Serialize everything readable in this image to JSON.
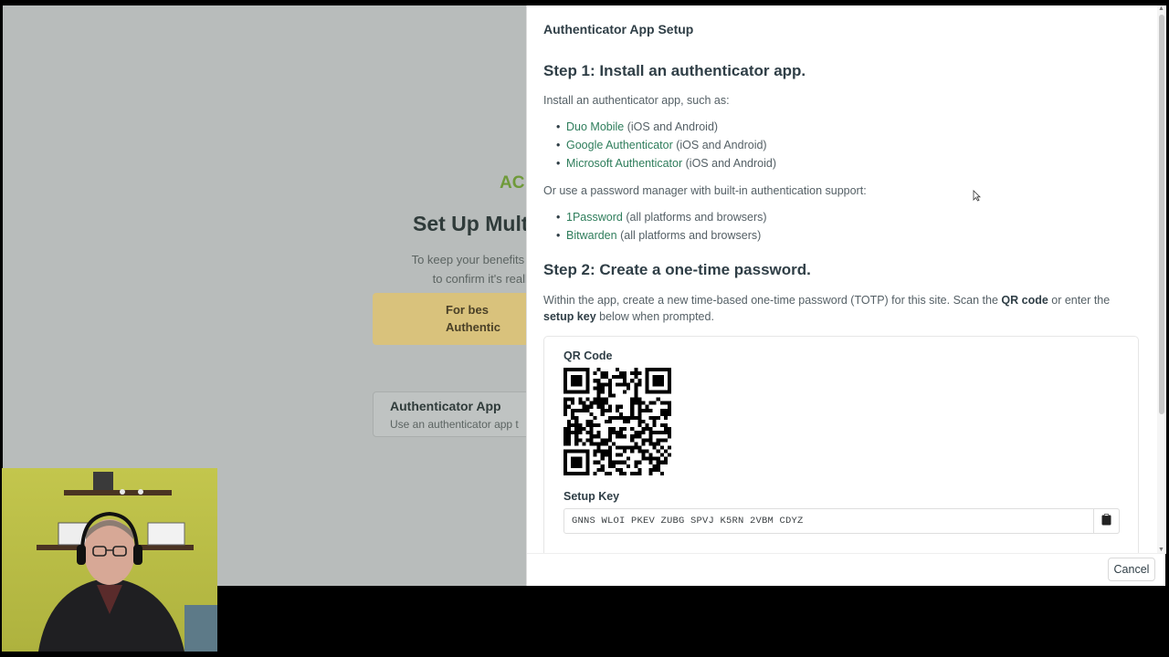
{
  "background": {
    "brand_fragment": "AC",
    "title_fragment": "Set Up Mult",
    "desc_line1": "To keep your benefits inforr",
    "desc_line2": "to confirm it's really",
    "notice_line1": "For bes",
    "notice_line2": "Authentic",
    "card_title": "Authenticator App",
    "card_desc": "Use an authenticator app t"
  },
  "modal": {
    "title": "Authenticator App Setup",
    "step1": {
      "heading": "Step 1: Install an authenticator app.",
      "intro": "Install an authenticator app, such as:",
      "apps": [
        {
          "name": "Duo Mobile",
          "platforms": "(iOS and Android)"
        },
        {
          "name": "Google Authenticator",
          "platforms": "(iOS and Android)"
        },
        {
          "name": "Microsoft Authenticator",
          "platforms": "(iOS and Android)"
        }
      ],
      "alt_intro": "Or use a password manager with built-in authentication support:",
      "managers": [
        {
          "name": "1Password",
          "platforms": "(all platforms and browsers)"
        },
        {
          "name": "Bitwarden",
          "platforms": "(all platforms and browsers)"
        }
      ]
    },
    "step2": {
      "heading": "Step 2: Create a one-time password.",
      "text_before": "Within the app, create a new time-based one-time password (TOTP) for this site. Scan the ",
      "qr_term": "QR code",
      "text_middle": " or enter the ",
      "key_term": "setup key",
      "text_after": " below when prompted."
    },
    "qr_label": "QR Code",
    "setup_key_label": "Setup Key",
    "setup_key": "GNNS WLOI PKEV ZUBG SPVJ K5RN 2VBM CDYZ",
    "cancel_label": "Cancel"
  },
  "icons": {
    "copy": "clipboard-icon",
    "cursor": "mouse-pointer-icon"
  },
  "colors": {
    "link": "#2e7d5b",
    "heading": "#2f3e46",
    "brand_green": "#6f9a3a",
    "notice_yellow": "#d9c27c"
  }
}
